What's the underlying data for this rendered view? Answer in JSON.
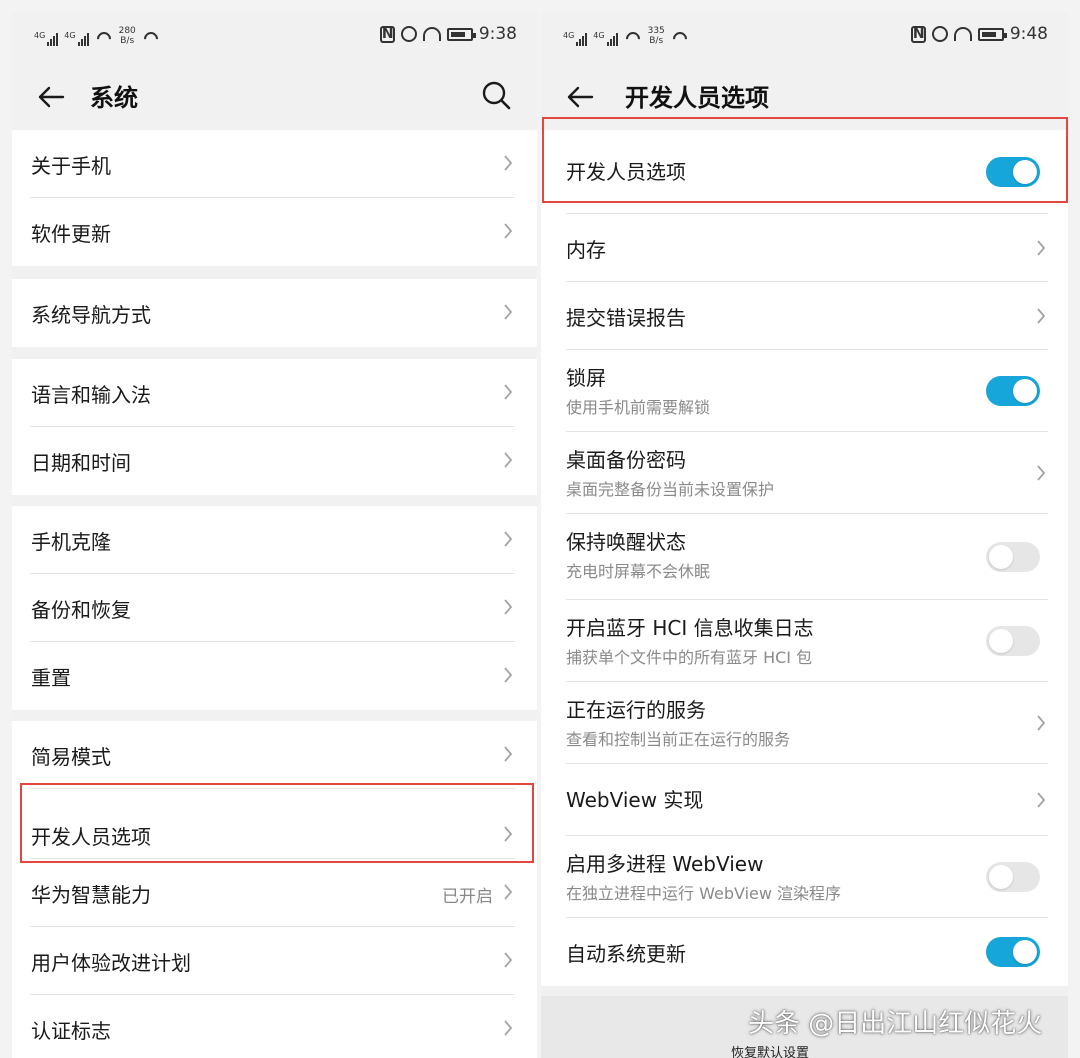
{
  "left": {
    "status": {
      "net1": "4G",
      "net2": "4G",
      "speed_value": "280",
      "speed_unit": "B/s",
      "time": "9:38"
    },
    "header": {
      "title": "系统"
    },
    "groups": [
      {
        "items": [
          {
            "label": "关于手机"
          },
          {
            "label": "软件更新"
          }
        ]
      },
      {
        "items": [
          {
            "label": "系统导航方式"
          }
        ]
      },
      {
        "items": [
          {
            "label": "语言和输入法"
          },
          {
            "label": "日期和时间"
          }
        ]
      },
      {
        "items": [
          {
            "label": "手机克隆"
          },
          {
            "label": "备份和恢复"
          },
          {
            "label": "重置"
          }
        ]
      },
      {
        "items": [
          {
            "label": "简易模式"
          },
          {
            "label": "开发人员选项"
          },
          {
            "label": "华为智慧能力",
            "status": "已开启"
          },
          {
            "label": "用户体验改进计划"
          },
          {
            "label": "认证标志"
          }
        ]
      }
    ]
  },
  "right": {
    "status": {
      "net1": "4G",
      "net2": "4G",
      "speed_value": "335",
      "speed_unit": "B/s",
      "time": "9:48"
    },
    "header": {
      "title": "开发人员选项"
    },
    "items": [
      {
        "label": "开发人员选项",
        "toggle": true
      },
      {
        "label": "内存"
      },
      {
        "label": "提交错误报告"
      },
      {
        "label": "锁屏",
        "sub": "使用手机前需要解锁",
        "toggle": true
      },
      {
        "label": "桌面备份密码",
        "sub": "桌面完整备份当前未设置保护"
      },
      {
        "label": "保持唤醒状态",
        "sub": "充电时屏幕不会休眠",
        "toggle": false
      },
      {
        "label": "开启蓝牙 HCI 信息收集日志",
        "sub": "捕获单个文件中的所有蓝牙 HCI 包",
        "toggle": false
      },
      {
        "label": "正在运行的服务",
        "sub": "查看和控制当前正在运行的服务"
      },
      {
        "label": "WebView 实现"
      },
      {
        "label": "启用多进程 WebView",
        "sub": "在独立进程中运行 WebView 渲染程序",
        "toggle": false
      },
      {
        "label": "自动系统更新",
        "toggle": true
      }
    ],
    "restore_label": "恢复默认设置"
  },
  "colors": {
    "accent": "#16a6d9",
    "highlight": "#e3473e"
  },
  "watermark": "头条 @日出江山红似花火"
}
